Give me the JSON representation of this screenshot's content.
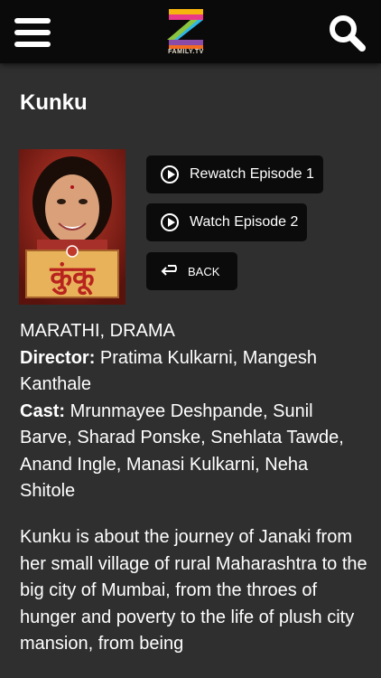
{
  "header": {
    "menu_icon": "hamburger-menu-icon",
    "logo_text": "FAMILY.TV",
    "search_icon": "search-icon"
  },
  "show": {
    "title": "Kunku",
    "poster_caption": "कुंकू",
    "genres": "MARATHI, DRAMA",
    "director_label": "Director:",
    "director": "Pratima Kulkarni, Mangesh Kanthale",
    "cast_label": "Cast:",
    "cast": "Mrunmayee Deshpande, Sunil Barve, Sharad Ponske, Snehlata Tawde, Anand Ingle, Manasi Kulkarni, Neha Shitole",
    "synopsis": "Kunku is about the journey of Janaki from her small village of rural Maharashtra to the big city of Mumbai, from the throes of hunger and poverty to the life of plush city mansion, from being"
  },
  "actions": {
    "rewatch_label": "Rewatch Episode 1",
    "watch_label": "Watch Episode 2",
    "back_label": "BACK"
  },
  "colors": {
    "background": "#2f2f2f",
    "topbar": "#0a0a0a",
    "button": "#0b0b0b",
    "text": "#ffffff"
  }
}
